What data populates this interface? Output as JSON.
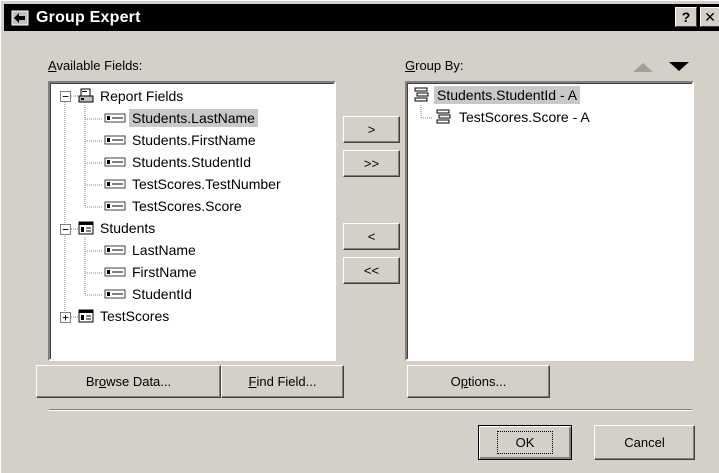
{
  "window": {
    "title": "Group Expert",
    "help_label": "?",
    "close_label": "✕"
  },
  "available": {
    "label_prefix": "",
    "label_mnemonic": "A",
    "label_rest": "vailable Fields:",
    "tree": [
      {
        "label": "Report Fields",
        "level": 0,
        "icon": "report-fields-icon",
        "expander": "−"
      },
      {
        "label": "Students.LastName",
        "level": 1,
        "icon": "field-icon",
        "selected": true
      },
      {
        "label": "Students.FirstName",
        "level": 1,
        "icon": "field-icon"
      },
      {
        "label": "Students.StudentId",
        "level": 1,
        "icon": "field-icon"
      },
      {
        "label": "TestScores.TestNumber",
        "level": 1,
        "icon": "field-icon"
      },
      {
        "label": "TestScores.Score",
        "level": 1,
        "icon": "field-icon"
      },
      {
        "label": "Students",
        "level": 0,
        "icon": "table-icon",
        "expander": "−"
      },
      {
        "label": "LastName",
        "level": 1,
        "icon": "field-icon"
      },
      {
        "label": "FirstName",
        "level": 1,
        "icon": "field-icon"
      },
      {
        "label": "StudentId",
        "level": 1,
        "icon": "field-icon"
      },
      {
        "label": "TestScores",
        "level": 0,
        "icon": "table-icon",
        "expander": "+"
      }
    ]
  },
  "group_by": {
    "label_mnemonic": "G",
    "label_rest": "roup By:",
    "items": [
      {
        "label": "Students.StudentId - A",
        "level": 0,
        "selected": true
      },
      {
        "label": "TestScores.Score - A",
        "level": 1
      }
    ]
  },
  "transfer": {
    "add": ">",
    "add_all": ">>",
    "remove": "<",
    "remove_all": "<<"
  },
  "buttons": {
    "browse_pre": "Br",
    "browse_mn": "o",
    "browse_post": "wse Data...",
    "find_pre": "",
    "find_mn": "F",
    "find_post": "ind Field...",
    "options_pre": "O",
    "options_mn": "p",
    "options_post": "tions...",
    "ok": "OK",
    "cancel": "Cancel"
  },
  "colors": {
    "face": "#d4d0c8",
    "title_bg": "#000000",
    "selection": "#c8c8c8"
  }
}
